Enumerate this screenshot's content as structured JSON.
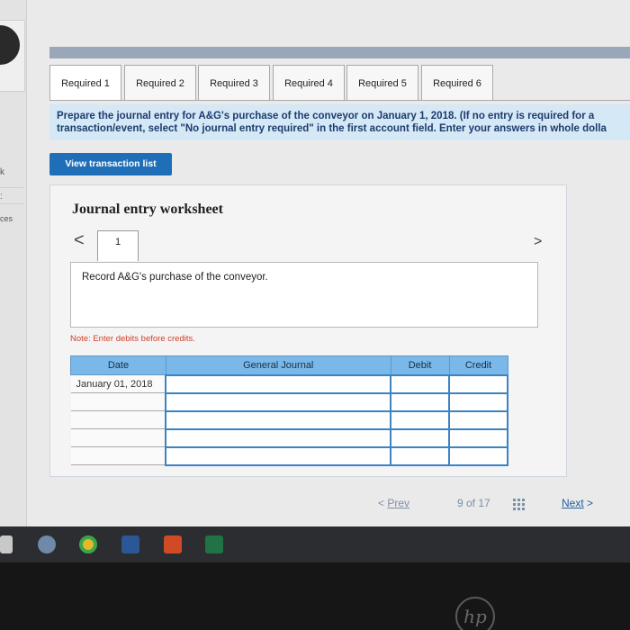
{
  "left_panel": {
    "fragments": [
      "k",
      ":",
      "ces"
    ]
  },
  "tabs": [
    {
      "label": "Required 1",
      "active": true
    },
    {
      "label": "Required 2",
      "active": false
    },
    {
      "label": "Required 3",
      "active": false
    },
    {
      "label": "Required 4",
      "active": false
    },
    {
      "label": "Required 5",
      "active": false
    },
    {
      "label": "Required 6",
      "active": false
    }
  ],
  "instruction": {
    "line1": "Prepare the journal entry for A&G's purchase of the conveyor on January 1, 2018. (If no entry is required for a",
    "line2": "transaction/event, select \"No journal entry required\" in the first account field. Enter your answers in whole dolla"
  },
  "view_button": "View transaction list",
  "worksheet": {
    "title": "Journal entry worksheet",
    "prev_arrow": "<",
    "next_arrow": ">",
    "page_number": "1",
    "record_text": "Record A&G's purchase of the conveyor.",
    "note": "Note: Enter debits before credits."
  },
  "journal": {
    "headers": {
      "date": "Date",
      "account": "General Journal",
      "debit": "Debit",
      "credit": "Credit"
    },
    "rows": [
      {
        "date": "January 01, 2018",
        "account": "",
        "debit": "",
        "credit": ""
      },
      {
        "date": "",
        "account": "",
        "debit": "",
        "credit": ""
      },
      {
        "date": "",
        "account": "",
        "debit": "",
        "credit": ""
      },
      {
        "date": "",
        "account": "",
        "debit": "",
        "credit": ""
      },
      {
        "date": "",
        "account": "",
        "debit": "",
        "credit": ""
      }
    ]
  },
  "pager": {
    "prev_label": "Prev",
    "count": "9 of 17",
    "next_label": "Next"
  },
  "taskbar": {
    "icons": [
      "windows-icon",
      "edge-icon",
      "chrome-icon",
      "word-icon",
      "powerpoint-icon",
      "excel-icon"
    ]
  },
  "colors": {
    "tab_border": "#a9a9a9",
    "instruction_bg": "#d5e8f6",
    "instruction_text": "#1d3c6e",
    "button_blue": "#1f6fb8",
    "table_header": "#79b8e8",
    "cell_border": "#3b84c4",
    "note_red": "#d2402a"
  },
  "brand": {
    "logo": "hp"
  }
}
